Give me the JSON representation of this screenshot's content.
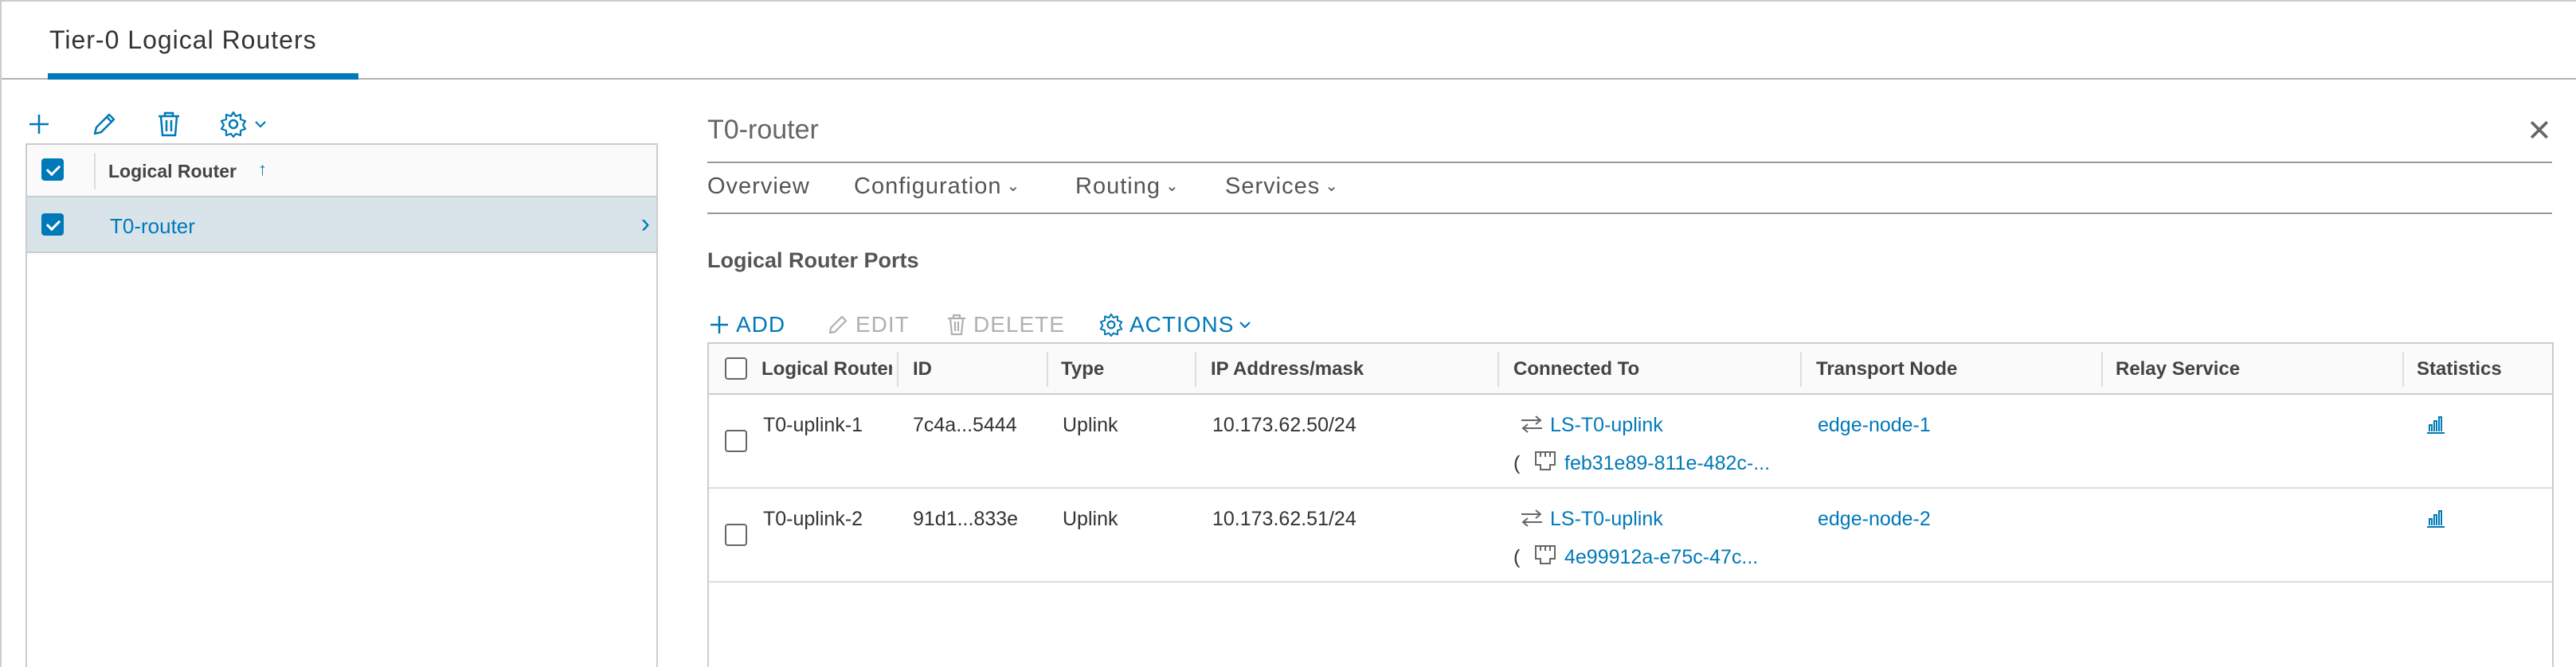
{
  "header": {
    "tab_title": "Tier-0 Logical Routers"
  },
  "left_panel": {
    "toolbar": {
      "add_icon": "plus-icon",
      "edit_icon": "pencil-icon",
      "delete_icon": "trash-icon",
      "settings_icon": "gear-icon"
    },
    "grid": {
      "column_header": "Logical Router",
      "sort_indicator": "↑",
      "rows": [
        {
          "label": "T0-router",
          "selected": true
        }
      ]
    }
  },
  "detail": {
    "title": "T0-router",
    "close_icon": "close-icon",
    "nav": [
      {
        "label": "Overview"
      },
      {
        "label": "Configuration"
      },
      {
        "label": "Routing"
      },
      {
        "label": "Services"
      }
    ],
    "section_title": "Logical Router Ports",
    "actions": {
      "add": "ADD",
      "edit": "EDIT",
      "delete": "DELETE",
      "actions": "ACTIONS"
    },
    "table": {
      "columns": [
        "Logical Router",
        "ID",
        "Type",
        "IP Address/mask",
        "Connected To",
        "Transport Node",
        "Relay Service",
        "Statistics"
      ],
      "rows": [
        {
          "name": "T0-uplink-1",
          "id": "7c4a...5444",
          "type": "Uplink",
          "ip": "10.173.62.50/24",
          "switch": "LS-T0-uplink",
          "paren": "(",
          "port": "feb31e89-811e-482c-...",
          "transport_node": "edge-node-1",
          "relay_service": "",
          "statistics_icon": "bar-chart-icon"
        },
        {
          "name": "T0-uplink-2",
          "id": "91d1...833e",
          "type": "Uplink",
          "ip": "10.173.62.51/24",
          "switch": "LS-T0-uplink",
          "paren": "(",
          "port": "4e99912a-e75c-47c...",
          "transport_node": "edge-node-2",
          "relay_service": "",
          "statistics_icon": "bar-chart-icon"
        }
      ]
    }
  },
  "colors": {
    "accent": "#0079b8",
    "selected_row": "#d9e4ea",
    "disabled": "#b0b0b0"
  }
}
